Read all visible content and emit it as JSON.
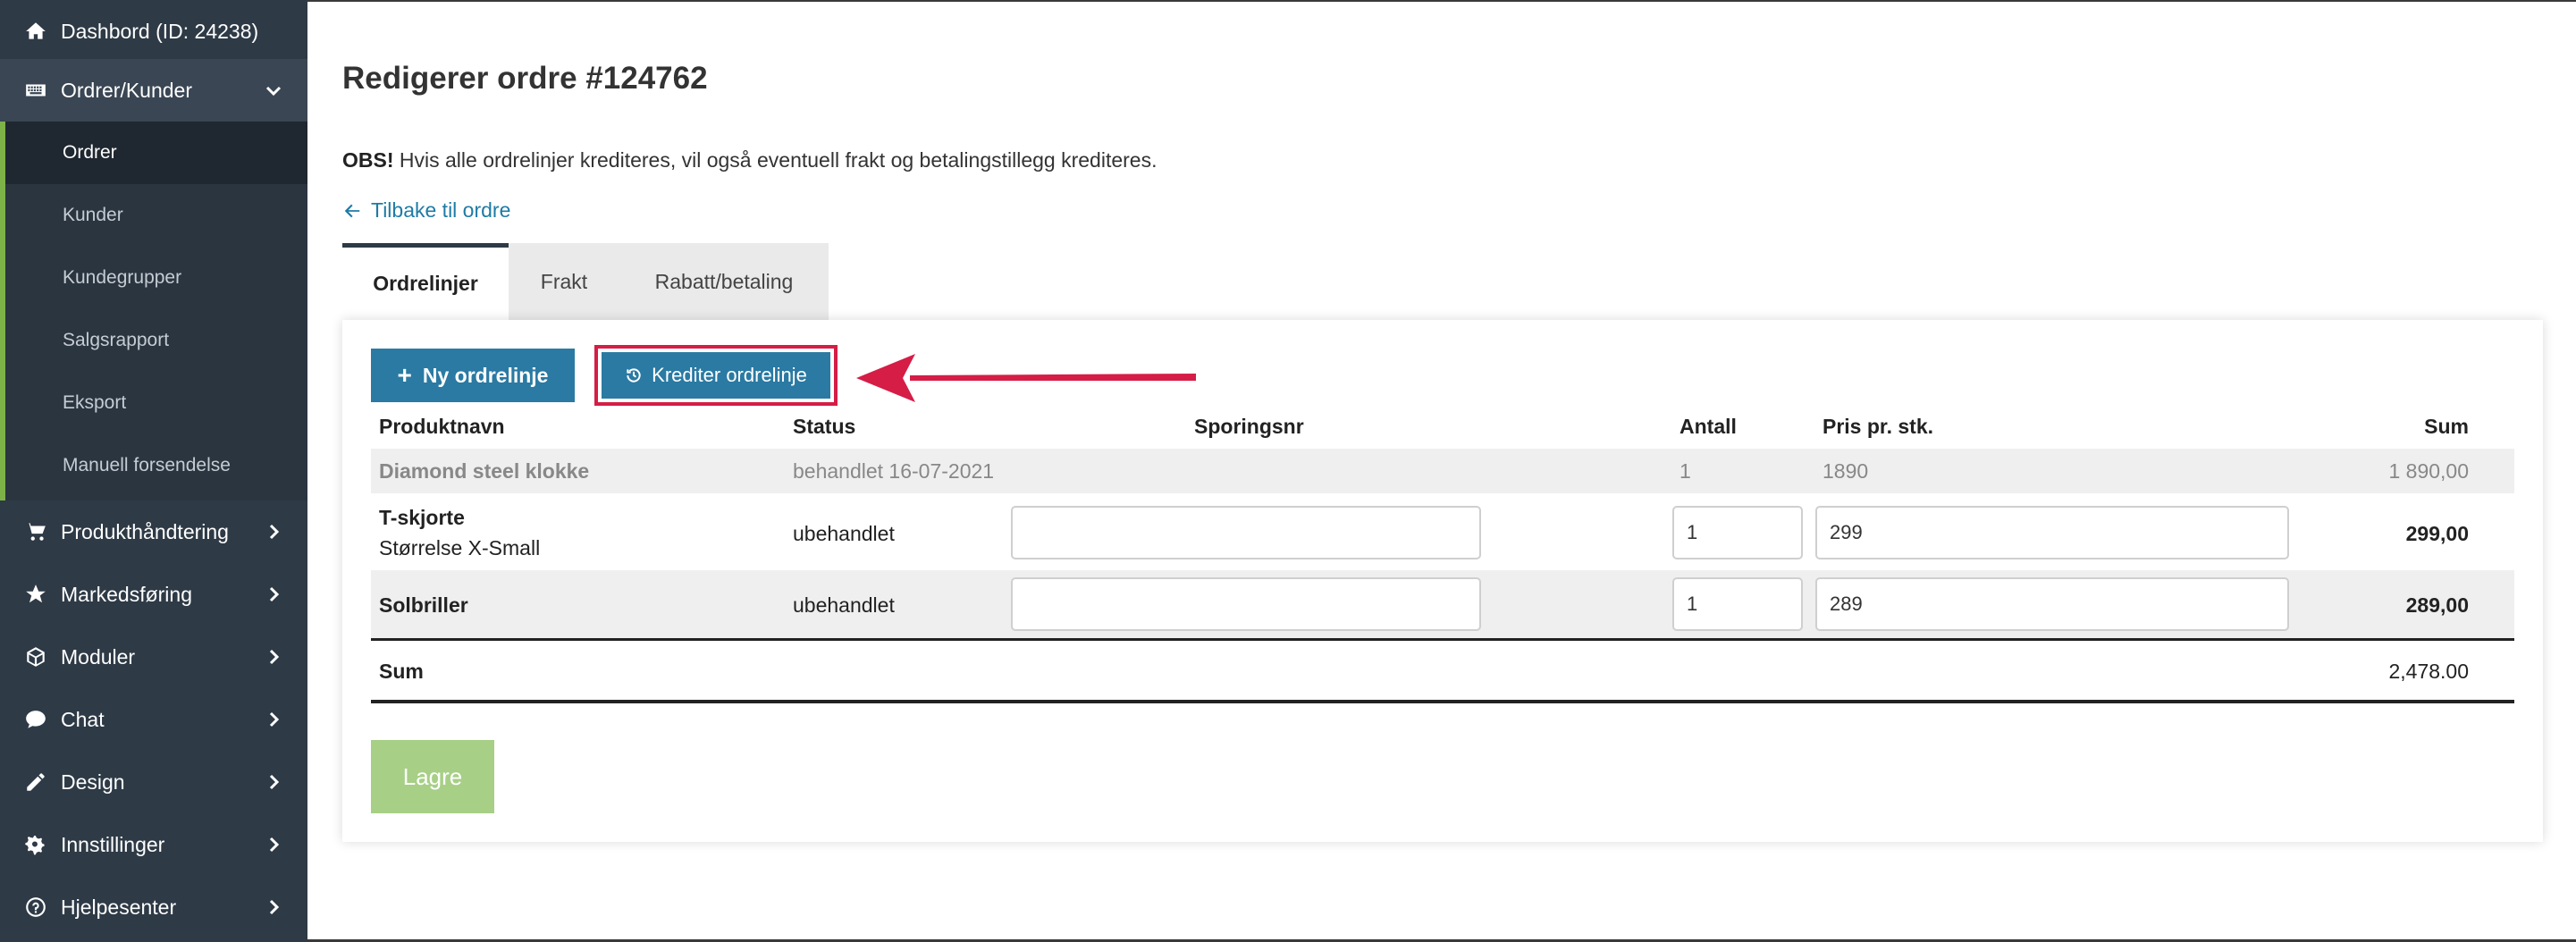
{
  "sidebar": {
    "items": [
      {
        "label": "Dashbord (ID: 24238)",
        "icon": "home-icon"
      },
      {
        "label": "Ordrer/Kunder",
        "icon": "keyboard-icon"
      },
      {
        "label": "Produkthåndtering",
        "icon": "cart-icon"
      },
      {
        "label": "Markedsføring",
        "icon": "star-icon"
      },
      {
        "label": "Moduler",
        "icon": "cube-icon"
      },
      {
        "label": "Chat",
        "icon": "chat-icon"
      },
      {
        "label": "Design",
        "icon": "pencil-icon"
      },
      {
        "label": "Innstillinger",
        "icon": "cogs-icon"
      },
      {
        "label": "Hjelpesenter",
        "icon": "help-icon"
      }
    ],
    "subitems": [
      "Ordrer",
      "Kunder",
      "Kundegrupper",
      "Salgsrapport",
      "Eksport",
      "Manuell forsendelse"
    ],
    "accent_color": "#7db249"
  },
  "main": {
    "title": "Redigerer ordre #124762",
    "notice_bold": "OBS!",
    "notice_text": " Hvis alle ordrelinjer krediteres, vil også eventuell frakt og betalingstillegg krediteres.",
    "back_link": "Tilbake til ordre",
    "tabs": [
      "Ordrelinjer",
      "Frakt",
      "Rabatt/betaling"
    ],
    "buttons": {
      "new_line": "Ny ordrelinje",
      "credit_line": "Krediter ordrelinje",
      "save": "Lagre"
    },
    "columns": [
      "Produktnavn",
      "Status",
      "Sporingsnr",
      "Antall",
      "Pris pr. stk.",
      "Sum"
    ],
    "rows": [
      {
        "name": "Diamond steel klokke",
        "variant": "",
        "status": "behandlet 16-07-2021",
        "tracking": "",
        "qty": "1",
        "price": "1890",
        "sum": "1 890,00"
      },
      {
        "name": "T-skjorte",
        "variant": "Størrelse X-Small",
        "status": "ubehandlet",
        "tracking": "",
        "qty": "1",
        "price": "299",
        "sum": "299,00"
      },
      {
        "name": "Solbriller",
        "variant": "",
        "status": "ubehandlet",
        "tracking": "",
        "qty": "1",
        "price": "289",
        "sum": "289,00"
      }
    ],
    "sum_label": "Sum",
    "sum_total": "2,478.00"
  },
  "colors": {
    "primary_button": "#2a7aa3",
    "highlight": "#d51d46",
    "save_disabled": "#a7cf86"
  }
}
